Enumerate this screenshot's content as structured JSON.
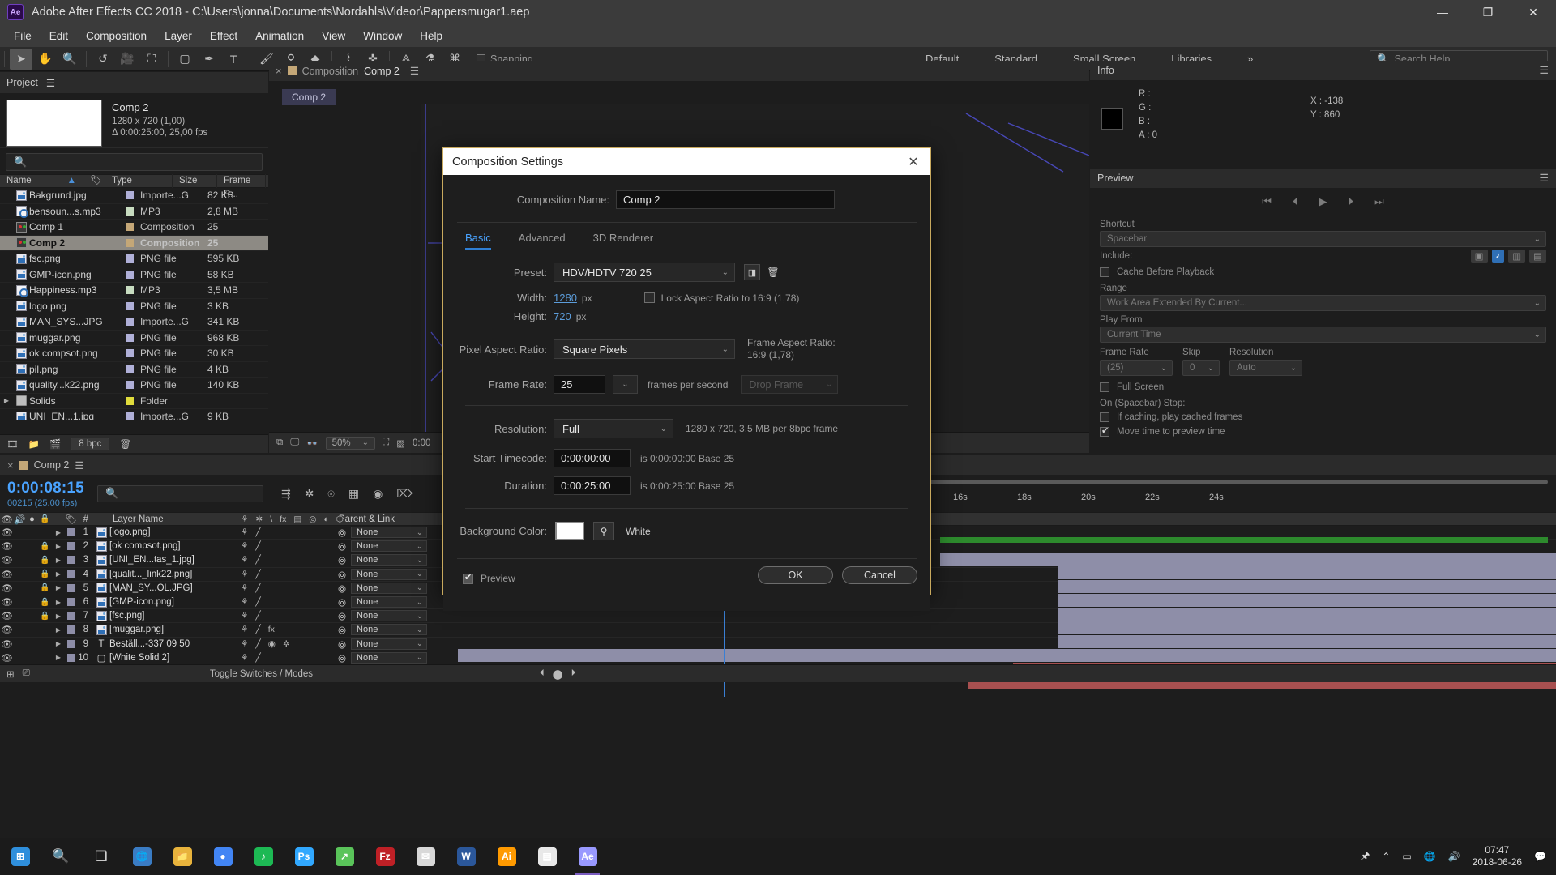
{
  "titlebar": {
    "app_icon": "after-effects-logo",
    "title": "Adobe After Effects CC 2018 - C:\\Users\\jonna\\Documents\\Nordahls\\Videor\\Pappersmugar1.aep",
    "minimize": "—",
    "maximize": "❐",
    "close": "✕"
  },
  "menubar": [
    "File",
    "Edit",
    "Composition",
    "Layer",
    "Effect",
    "Animation",
    "View",
    "Window",
    "Help"
  ],
  "toolbar": {
    "snapping_label": "Snapping",
    "workspaces": [
      "Default",
      "Standard",
      "Small Screen",
      "Libraries"
    ],
    "overflow": "»",
    "search_placeholder": "Search Help"
  },
  "project_panel": {
    "tab_label": "Project",
    "comp_name": "Comp 2",
    "comp_res": "1280 x 720 (1,00)",
    "comp_dur": "Δ 0:00:25:00, 25,00 fps",
    "search_placeholder": "",
    "columns": [
      "Name",
      "Type",
      "Size",
      "Frame R..."
    ],
    "items": [
      {
        "name": "Bakgrund.jpg",
        "icon": "image-file-icon",
        "swatch": "#b0b0d8",
        "type": "Importe...G",
        "size": "82 KB",
        "selected": false
      },
      {
        "name": "bensoun...s.mp3",
        "icon": "audio-file-icon",
        "swatch": "#c8dcc0",
        "type": "MP3",
        "size": "2,8 MB",
        "selected": false
      },
      {
        "name": "Comp 1",
        "icon": "composition-icon",
        "swatch": "#c4a777",
        "type": "Composition",
        "size": "25",
        "selected": false
      },
      {
        "name": "Comp 2",
        "icon": "composition-icon",
        "swatch": "#c4a777",
        "type": "Composition",
        "size": "25",
        "selected": true
      },
      {
        "name": "fsc.png",
        "icon": "image-file-icon",
        "swatch": "#b0b0d8",
        "type": "PNG file",
        "size": "595 KB",
        "selected": false
      },
      {
        "name": "GMP-icon.png",
        "icon": "image-file-icon",
        "swatch": "#b0b0d8",
        "type": "PNG file",
        "size": "58 KB",
        "selected": false
      },
      {
        "name": "Happiness.mp3",
        "icon": "audio-file-icon",
        "swatch": "#c8dcc0",
        "type": "MP3",
        "size": "3,5 MB",
        "selected": false
      },
      {
        "name": "logo.png",
        "icon": "image-file-icon",
        "swatch": "#b0b0d8",
        "type": "PNG file",
        "size": "3 KB",
        "selected": false
      },
      {
        "name": "MAN_SYS...JPG",
        "icon": "image-file-icon",
        "swatch": "#b0b0d8",
        "type": "Importe...G",
        "size": "341 KB",
        "selected": false
      },
      {
        "name": "muggar.png",
        "icon": "image-file-icon",
        "swatch": "#b0b0d8",
        "type": "PNG file",
        "size": "968 KB",
        "selected": false
      },
      {
        "name": "ok compsot.png",
        "icon": "image-file-icon",
        "swatch": "#b0b0d8",
        "type": "PNG file",
        "size": "30 KB",
        "selected": false
      },
      {
        "name": "pil.png",
        "icon": "image-file-icon",
        "swatch": "#b0b0d8",
        "type": "PNG file",
        "size": "4 KB",
        "selected": false
      },
      {
        "name": "quality...k22.png",
        "icon": "image-file-icon",
        "swatch": "#b0b0d8",
        "type": "PNG file",
        "size": "140 KB",
        "selected": false
      },
      {
        "name": "Solids",
        "icon": "folder-icon",
        "swatch": "#e0dc3c",
        "type": "Folder",
        "size": "",
        "selected": false
      },
      {
        "name": "UNI_EN...1.jpg",
        "icon": "image-file-icon",
        "swatch": "#b0b0d8",
        "type": "Importe...G",
        "size": "9 KB",
        "selected": false
      }
    ],
    "bit_depth": "8 bpc"
  },
  "comp_panel": {
    "tab_label": "Composition",
    "comp_name": "Comp 2",
    "inner_tab": "Comp 2",
    "zoom": "50%",
    "timecode": "0:00"
  },
  "info_panel": {
    "tab_label": "Info",
    "r": "R :",
    "g": "G :",
    "b": "B :",
    "a": "A : 0",
    "x": "X : -138",
    "y": "Y : 860"
  },
  "preview_panel": {
    "tab_label": "Preview",
    "shortcut_label": "Shortcut",
    "shortcut_value": "Spacebar",
    "include_label": "Include:",
    "cache_label": "Cache Before Playback",
    "range_label": "Range",
    "range_value": "Work Area Extended By Current...",
    "play_from_label": "Play From",
    "play_from_value": "Current Time",
    "frame_rate_label": "Frame Rate",
    "frame_rate_value": "(25)",
    "skip_label": "Skip",
    "skip_value": "0",
    "resolution_label": "Resolution",
    "resolution_value": "Auto",
    "full_screen_label": "Full Screen",
    "on_stop_label": "On (Spacebar) Stop:",
    "cached_frames_label": "If caching, play cached frames",
    "move_time_label": "Move time to preview time"
  },
  "timeline": {
    "tab_label": "Comp 2",
    "current_time": "0:00:08:15",
    "frame_info": "00215 (25.00 fps)",
    "search_placeholder": "",
    "columns": {
      "num": "#",
      "layer_name": "Layer Name",
      "parent": "Parent & Link"
    },
    "ruler_ticks": [
      "16s",
      "18s",
      "20s",
      "22s",
      "24s"
    ],
    "layers": [
      {
        "num": "1",
        "name": "[logo.png]",
        "icon": "image-layer-icon",
        "parent": "None",
        "locked": false,
        "fx": false
      },
      {
        "num": "2",
        "name": "[ok compsot.png]",
        "icon": "image-layer-icon",
        "parent": "None",
        "locked": true,
        "fx": false
      },
      {
        "num": "3",
        "name": "[UNI_EN...tas_1.jpg]",
        "icon": "image-layer-icon",
        "parent": "None",
        "locked": true,
        "fx": false
      },
      {
        "num": "4",
        "name": "[qualit..._link22.png]",
        "icon": "image-layer-icon",
        "parent": "None",
        "locked": true,
        "fx": false
      },
      {
        "num": "5",
        "name": "[MAN_SY...OL.JPG]",
        "icon": "image-layer-icon",
        "parent": "None",
        "locked": true,
        "fx": false
      },
      {
        "num": "6",
        "name": "[GMP-icon.png]",
        "icon": "image-layer-icon",
        "parent": "None",
        "locked": true,
        "fx": false
      },
      {
        "num": "7",
        "name": "[fsc.png]",
        "icon": "image-layer-icon",
        "parent": "None",
        "locked": true,
        "fx": false
      },
      {
        "num": "8",
        "name": "[muggar.png]",
        "icon": "image-layer-icon",
        "parent": "None",
        "locked": false,
        "fx": true
      },
      {
        "num": "9",
        "name": "Beställ...-337 09 50",
        "icon": "text-layer-icon",
        "parent": "None",
        "locked": false,
        "fx": false
      },
      {
        "num": "10",
        "name": "[White Solid 2]",
        "icon": "solid-layer-icon",
        "parent": "None",
        "locked": false,
        "fx": false
      }
    ],
    "footer_label": "Toggle Switches / Modes"
  },
  "dialog": {
    "title": "Composition Settings",
    "close_icon": "✕",
    "composition_name_label": "Composition Name:",
    "composition_name_value": "Comp 2",
    "tabs": [
      {
        "label": "Basic",
        "active": true
      },
      {
        "label": "Advanced",
        "active": false
      },
      {
        "label": "3D Renderer",
        "active": false
      }
    ],
    "preset_label": "Preset:",
    "preset_value": "HDV/HDTV 720 25",
    "preset_save_icon": "save-preset-icon",
    "preset_delete_icon": "trash-icon",
    "width_label": "Width:",
    "width_value": "1280",
    "width_unit": "px",
    "height_label": "Height:",
    "height_value": "720",
    "height_unit": "px",
    "lock_aspect_label": "Lock Aspect Ratio to 16:9 (1,78)",
    "lock_aspect_checked": false,
    "pixel_aspect_label": "Pixel Aspect Ratio:",
    "pixel_aspect_value": "Square Pixels",
    "frame_aspect_label": "Frame Aspect Ratio:",
    "frame_aspect_value": "16:9 (1,78)",
    "frame_rate_label": "Frame Rate:",
    "frame_rate_value": "25",
    "frame_rate_unit": "frames per second",
    "drop_frame_value": "Drop Frame",
    "resolution_label": "Resolution:",
    "resolution_value": "Full",
    "resolution_info": "1280 x 720, 3,5 MB per 8bpc frame",
    "start_timecode_label": "Start Timecode:",
    "start_timecode_value": "0:00:00:00",
    "start_timecode_info": "is 0:00:00:00  Base 25",
    "duration_label": "Duration:",
    "duration_value": "0:00:25:00",
    "duration_info": "is 0:00:25:00  Base 25",
    "background_color_label": "Background Color:",
    "background_color_hex": "#ffffff",
    "background_color_name": "White",
    "eyedropper_icon": "eyedropper-icon",
    "preview_label": "Preview",
    "preview_checked": true,
    "ok_label": "OK",
    "cancel_label": "Cancel"
  },
  "taskbar": {
    "start_icon": "windows-start-icon",
    "search_icon": "search-icon",
    "taskview_icon": "task-view-icon",
    "apps": [
      {
        "name": "firefox",
        "glyph": "🌐",
        "color": "#3a7cc4",
        "active": false
      },
      {
        "name": "file-explorer",
        "glyph": "📁",
        "color": "#e8b33c",
        "active": false
      },
      {
        "name": "chrome",
        "glyph": "●",
        "color": "#4285f4",
        "active": false
      },
      {
        "name": "spotify",
        "glyph": "♪",
        "color": "#1db954",
        "active": false
      },
      {
        "name": "photoshop",
        "glyph": "Ps",
        "color": "#31a8ff",
        "active": false
      },
      {
        "name": "green-app",
        "glyph": "↗",
        "color": "#5ac45a",
        "active": false
      },
      {
        "name": "filezilla",
        "glyph": "Fz",
        "color": "#bf2026",
        "active": false
      },
      {
        "name": "mail",
        "glyph": "✉",
        "color": "#d8d8d8",
        "active": false
      },
      {
        "name": "word",
        "glyph": "W",
        "color": "#2b579a",
        "active": false
      },
      {
        "name": "illustrator",
        "glyph": "Ai",
        "color": "#ff9a00",
        "active": false
      },
      {
        "name": "sticky-notes",
        "glyph": "▤",
        "color": "#e8e8e8",
        "active": false
      },
      {
        "name": "after-effects",
        "glyph": "Ae",
        "color": "#9999ff",
        "active": true
      }
    ],
    "time": "07:47",
    "date": "2018-06-26",
    "notification_icon": "notification-icon"
  }
}
